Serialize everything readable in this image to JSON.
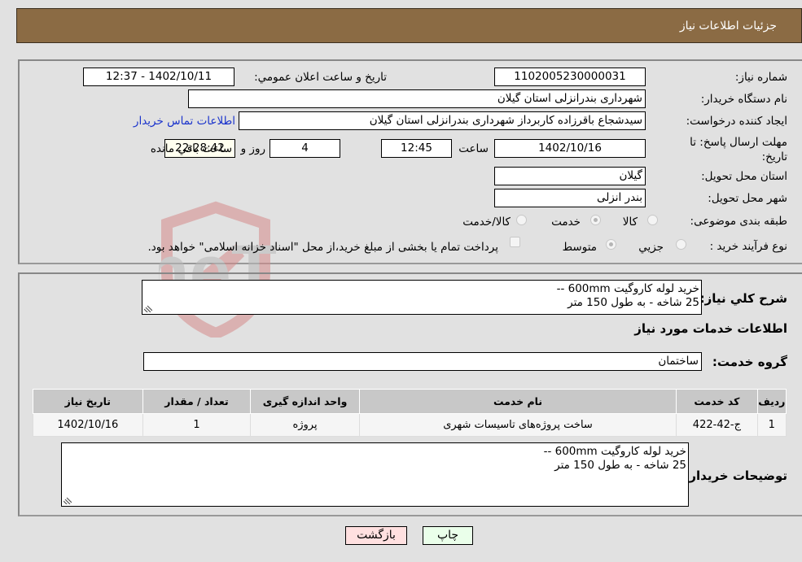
{
  "header": {
    "title": "جزئیات اطلاعات نیاز"
  },
  "form": {
    "need_number": {
      "label": "شماره نیاز:",
      "value": "1102005230000031"
    },
    "announce_datetime": {
      "label": "تاریخ و ساعت اعلان عمومي:",
      "value": "1402/10/11 - 12:37"
    },
    "buyer_org": {
      "label": "نام دستگاه خريدار:",
      "value": "شهرداری بندرانزلی استان گیلان"
    },
    "requester": {
      "label": "ایجاد کننده درخواست:",
      "value": "سیدشجاع باقرزاده کاربرداز شهرداری بندرانزلی استان گیلان"
    },
    "contact_link": "اطلاعات تماس خريدار",
    "deadline": {
      "label": "مهلت ارسال پاسخ: تا تاریخ:",
      "date": "1402/10/16",
      "time_label": "ساعت",
      "time": "12:45",
      "days": "4",
      "days_label": "روز و",
      "remaining": "22:28:42",
      "remaining_label": "ساعت باقي مانده"
    },
    "province": {
      "label": "استان محل تحویل:",
      "value": "گیلان"
    },
    "city": {
      "label": "شهر محل تحویل:",
      "value": "بندر انزلی"
    },
    "category": {
      "label": "طبقه بندی موضوعی:",
      "options": [
        {
          "label": "کالا",
          "checked": false
        },
        {
          "label": "خدمت",
          "checked": true
        },
        {
          "label": "کالا/خدمت",
          "checked": false
        }
      ]
    },
    "purchase_process": {
      "label": "نوع فرآیند خرید :",
      "options": [
        {
          "label": "جزيي",
          "checked": false
        },
        {
          "label": "متوسط",
          "checked": true
        }
      ],
      "treasury_note": "پرداخت تمام یا بخشی از مبلغ خرید،از محل \"اسناد خزانه اسلامی\" خواهد بود.",
      "treasury_checked": false
    }
  },
  "summary": {
    "label": "شرح کلي نياز:",
    "lines": [
      "خرید لوله کاروگیت 600mm --",
      "25 شاخه - به طول 150 متر"
    ]
  },
  "services_section": {
    "title": "اطلاعات خدمات مورد نياز",
    "group_label": "گروه خدمت:",
    "group_value": "ساختمان"
  },
  "table": {
    "headers": [
      "رديف",
      "کد خدمت",
      "نام خدمت",
      "واحد اندازه گیری",
      "تعداد / مقدار",
      "تاریخ نیاز"
    ],
    "rows": [
      [
        "1",
        "ج-42-422",
        "ساخت پروژه‌های تاسیسات شهری",
        "پروژه",
        "1",
        "1402/10/16"
      ]
    ]
  },
  "buyer_notes": {
    "label": "توضیحات خریدار:",
    "lines": [
      "خرید لوله کاروگیت 600mm --",
      "25 شاخه - به طول 150 متر"
    ]
  },
  "buttons": {
    "print": "چاپ",
    "back": "بازگشت"
  },
  "watermark": {
    "text": "AriaTender.neT",
    "brand_color": "#d9534f"
  }
}
